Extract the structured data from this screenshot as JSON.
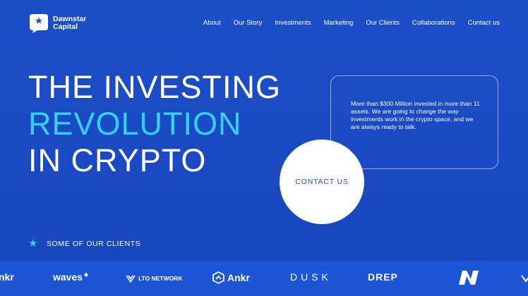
{
  "brand": {
    "line1": "Dawnstar",
    "line2": "Capital"
  },
  "nav": {
    "about": "About",
    "story": "Our Story",
    "investments": "Investments",
    "marketing": "Marketing",
    "clients": "Our Clients",
    "collaborations": "Collaborations",
    "contact": "Contact us"
  },
  "hero": {
    "line1": "THE INVESTING",
    "line2": "REVOLUTION",
    "line3": "IN CRYPTO"
  },
  "info": {
    "text": "More than $300 Million invested in more than 11 assets. We are going to change the way investments work in the crypto space, and we are always ready to talk."
  },
  "cta": {
    "label": "CONTACT US"
  },
  "clients": {
    "label": "SOME OF OUR CLIENTS",
    "logos": [
      "nkr",
      "waves",
      "LTO NETWORK",
      "Ankr",
      "DUSK",
      "DREP"
    ]
  },
  "colors": {
    "background": "#1c4ec9",
    "strip": "#1c56d6",
    "accent": "#35d1f2"
  }
}
